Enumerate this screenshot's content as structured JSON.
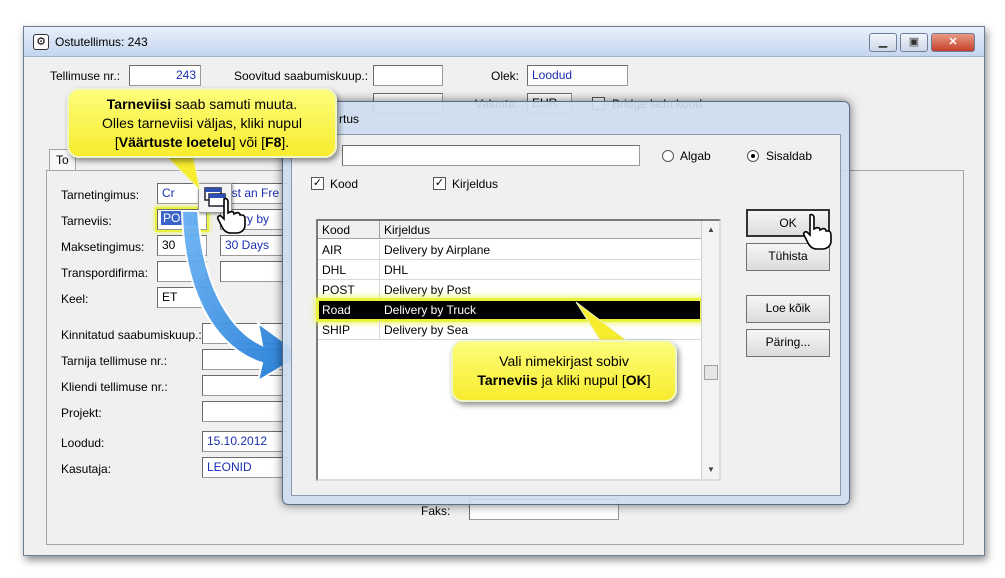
{
  "window": {
    "title": "Ostutellimus: 243",
    "minimize": "▁",
    "maximize": "▣",
    "close": "✕"
  },
  "header": {
    "order_no_label": "Tellimuse nr.:",
    "order_no": "243",
    "agreed_arrival_label": "Soovitud saabumiskuup.:",
    "agreed_arrival": "",
    "status_label": "Olek:",
    "status": "Loodud",
    "currency_label": "Valuuta:",
    "currency": "EUR",
    "bridge_label": "Bridge ladu kood",
    "tab_label": "To"
  },
  "form": {
    "delivery_terms_label": "Tarnetingimus:",
    "delivery_terms_code": "Cr",
    "delivery_terms_desc": "ust an Fre",
    "delivery_method_label": "Tarneviis:",
    "delivery_method_code": "POST",
    "delivery_method_desc": "livery by",
    "payment_terms_label": "Maksetingimus:",
    "payment_terms_code": "30",
    "payment_terms_desc": "30 Days",
    "transport_label": "Transpordifirma:",
    "language_label": "Keel:",
    "language": "ET",
    "confirmed_arrival_label": "Kinnitatud saabumiskuup.:",
    "supplier_order_label": "Tarnija tellimuse nr.:",
    "customer_order_label": "Kliendi tellimuse nr.:",
    "project_label": "Projekt:",
    "created_label": "Loodud:",
    "created": "15.10.2012",
    "user_label": "Kasutaja:",
    "user": "LEONID",
    "fax_label": "Faks:"
  },
  "dialog": {
    "title": "rtus",
    "search_value": "",
    "radio_starts": "Algab",
    "radio_contains": "Sisaldab",
    "check_code": "Kood",
    "check_desc": "Kirjeldus",
    "columns": [
      "Kood",
      "Kirjeldus"
    ],
    "rows": [
      {
        "code": "AIR",
        "desc": "Delivery by Airplane"
      },
      {
        "code": "DHL",
        "desc": "DHL"
      },
      {
        "code": "POST",
        "desc": "Delivery by Post"
      },
      {
        "code": "Road",
        "desc": "Delivery by Truck"
      },
      {
        "code": "SHIP",
        "desc": "Delivery by Sea"
      }
    ],
    "selected_row": 3,
    "btn_ok": "OK",
    "btn_cancel": "Tühista",
    "btn_load_all": "Loe kõik",
    "btn_query": "Päring..."
  },
  "callouts": {
    "top": {
      "bold1": "Tarneviisi",
      "text1": " saab samuti muuta.",
      "line2": "Olles tarneviisi väljas, kliki nupul",
      "open": "[",
      "bold2": "Väärtuste loetelu",
      "mid": "] või [",
      "bold3": "F8",
      "close": "]."
    },
    "bottom": {
      "line1": "Vali nimekirjast sobiv",
      "bold1": "Tarneviis",
      "text2": " ja kliki nupul [",
      "bold2": "OK",
      "close": "]"
    }
  },
  "colors": {
    "callout": "#f7ec2e",
    "arrow": "#2f8fe0",
    "selection": "#000000",
    "highlight": "#e9f23a"
  }
}
